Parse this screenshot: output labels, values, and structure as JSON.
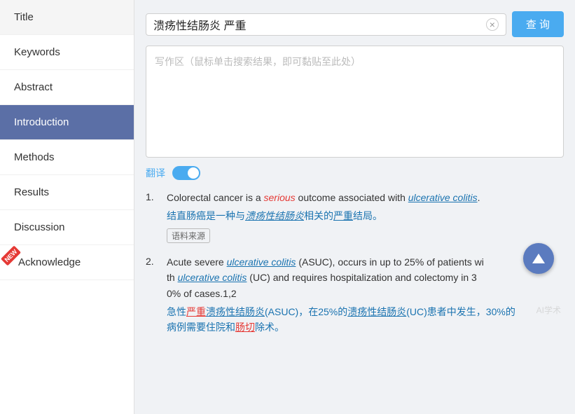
{
  "sidebar": {
    "items": [
      {
        "id": "title",
        "label": "Title",
        "active": false
      },
      {
        "id": "keywords",
        "label": "Keywords",
        "active": false
      },
      {
        "id": "abstract",
        "label": "Abstract",
        "active": false
      },
      {
        "id": "introduction",
        "label": "Introduction",
        "active": true
      },
      {
        "id": "methods",
        "label": "Methods",
        "active": false
      },
      {
        "id": "results",
        "label": "Results",
        "active": false
      },
      {
        "id": "discussion",
        "label": "Discussion",
        "active": false
      },
      {
        "id": "acknowledge",
        "label": "Acknowledge",
        "active": false,
        "badge": "NEW"
      }
    ]
  },
  "search": {
    "value": "溃疡性结肠炎 严重",
    "placeholder": "写作区（鼠标单击搜索结果，即可黏贴至此处）",
    "button_label": "查 询",
    "clear_label": "×"
  },
  "translate": {
    "label": "翻译"
  },
  "results": [
    {
      "num": "1.",
      "en_parts": [
        {
          "text": "Colorectal cancer is a ",
          "style": "normal"
        },
        {
          "text": "serious",
          "style": "italic-red"
        },
        {
          "text": " outcome associated with ",
          "style": "normal"
        },
        {
          "text": "ulcerative colitis",
          "style": "italic-blue-underline"
        },
        {
          "text": ".",
          "style": "normal"
        }
      ],
      "zh": "结直肠癌是一种与溃疡性结肠炎相关的严重结局。",
      "corpus_tag": "语料来源"
    },
    {
      "num": "2.",
      "en_parts": [
        {
          "text": "Acute severe ",
          "style": "normal"
        },
        {
          "text": "ulcerative colitis",
          "style": "italic-blue-underline"
        },
        {
          "text": " (ASUC), occurs in up to 25% of patients with ",
          "style": "normal"
        },
        {
          "text": "ulcerative colitis",
          "style": "italic-blue-underline"
        },
        {
          "text": " (UC) and requires hospitalization and colectomy in 30% of cases.1,2",
          "style": "normal"
        }
      ],
      "zh": "急性严重溃疡性结肠炎(ASUC)，在25%的溃疡性结肠炎(UC)患者中发生，30%的病例需要住院和肠切除术。"
    }
  ],
  "watermark": "AI学术",
  "scroll_up_label": "↑"
}
